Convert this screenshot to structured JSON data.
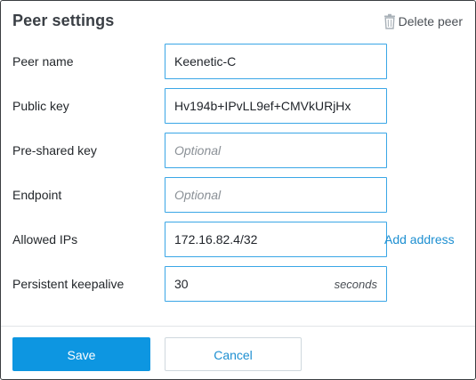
{
  "dialog": {
    "title": "Peer settings",
    "delete_label": "Delete peer"
  },
  "fields": {
    "peer_name": {
      "label": "Peer name",
      "value": "Keenetic-C"
    },
    "public_key": {
      "label": "Public key",
      "value": "Hv194b+IPvLL9ef+CMVkURjHx"
    },
    "preshared_key": {
      "label": "Pre-shared key",
      "value": "",
      "placeholder": "Optional"
    },
    "endpoint": {
      "label": "Endpoint",
      "value": "",
      "placeholder": "Optional"
    },
    "allowed_ips": {
      "label": "Allowed IPs",
      "value": "172.16.82.4/32",
      "add_label": "Add address"
    },
    "keepalive": {
      "label": "Persistent keepalive",
      "value": "30",
      "unit": "seconds"
    }
  },
  "actions": {
    "save_label": "Save",
    "cancel_label": "Cancel"
  },
  "colors": {
    "accent": "#0d96e1",
    "field_border": "#3aa6e6",
    "link": "#1d8fd1"
  },
  "icons": {
    "delete": "trash-icon"
  }
}
